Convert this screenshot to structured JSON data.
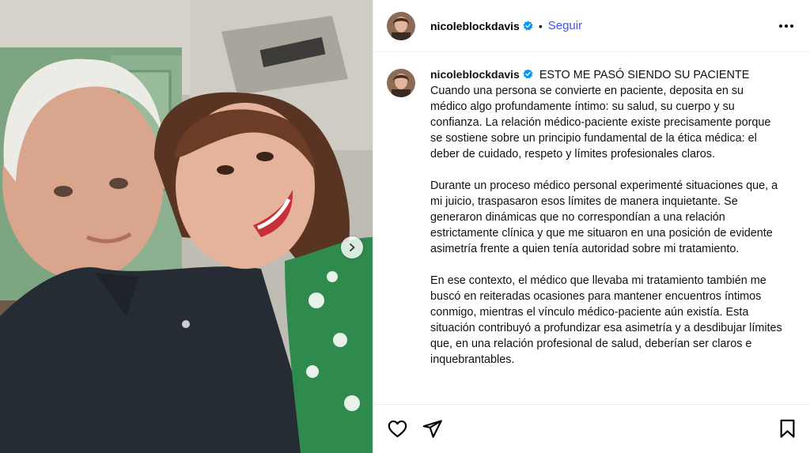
{
  "post": {
    "username": "nicoleblockdavis",
    "separator": "•",
    "follow_label": "Seguir",
    "caption": {
      "headline": "ESTO ME PASÓ SIENDO SU PACIENTE",
      "paragraph1": "Cuando una persona se convierte en paciente, deposita en su médico algo profundamente íntimo: su salud, su cuerpo y su confianza. La relación médico-paciente existe precisamente porque se sostiene sobre un principio fundamental de la ética médica: el deber de cuidado, respeto y límites profesionales claros.",
      "paragraph2": "Durante un proceso médico personal experimenté situaciones que, a mi juicio, traspasaron esos límites de manera inquietante. Se generaron dinámicas que no correspondían a una relación estrictamente clínica y que me situaron en una posición de evidente asimetría frente a quien tenía autoridad sobre mi tratamiento.",
      "paragraph3": "En ese contexto, el médico que llevaba mi tratamiento también me buscó en reiteradas ocasiones para mantener encuentros íntimos conmigo, mientras el vínculo médico-paciente aún existía. Esta situación contribuyó a profundizar esa asimetría y a desdibujar límites que, en una relación profesional de salud, deberían ser claros e inquebrantables."
    }
  },
  "icons": {
    "verified": "verified-badge-icon",
    "more": "more-options-icon",
    "next": "chevron-right-icon",
    "like": "heart-icon",
    "share": "paper-plane-icon",
    "save": "bookmark-icon"
  },
  "colors": {
    "follow": "#4150f7",
    "verified": "#0095f6",
    "divider": "#efefef"
  }
}
